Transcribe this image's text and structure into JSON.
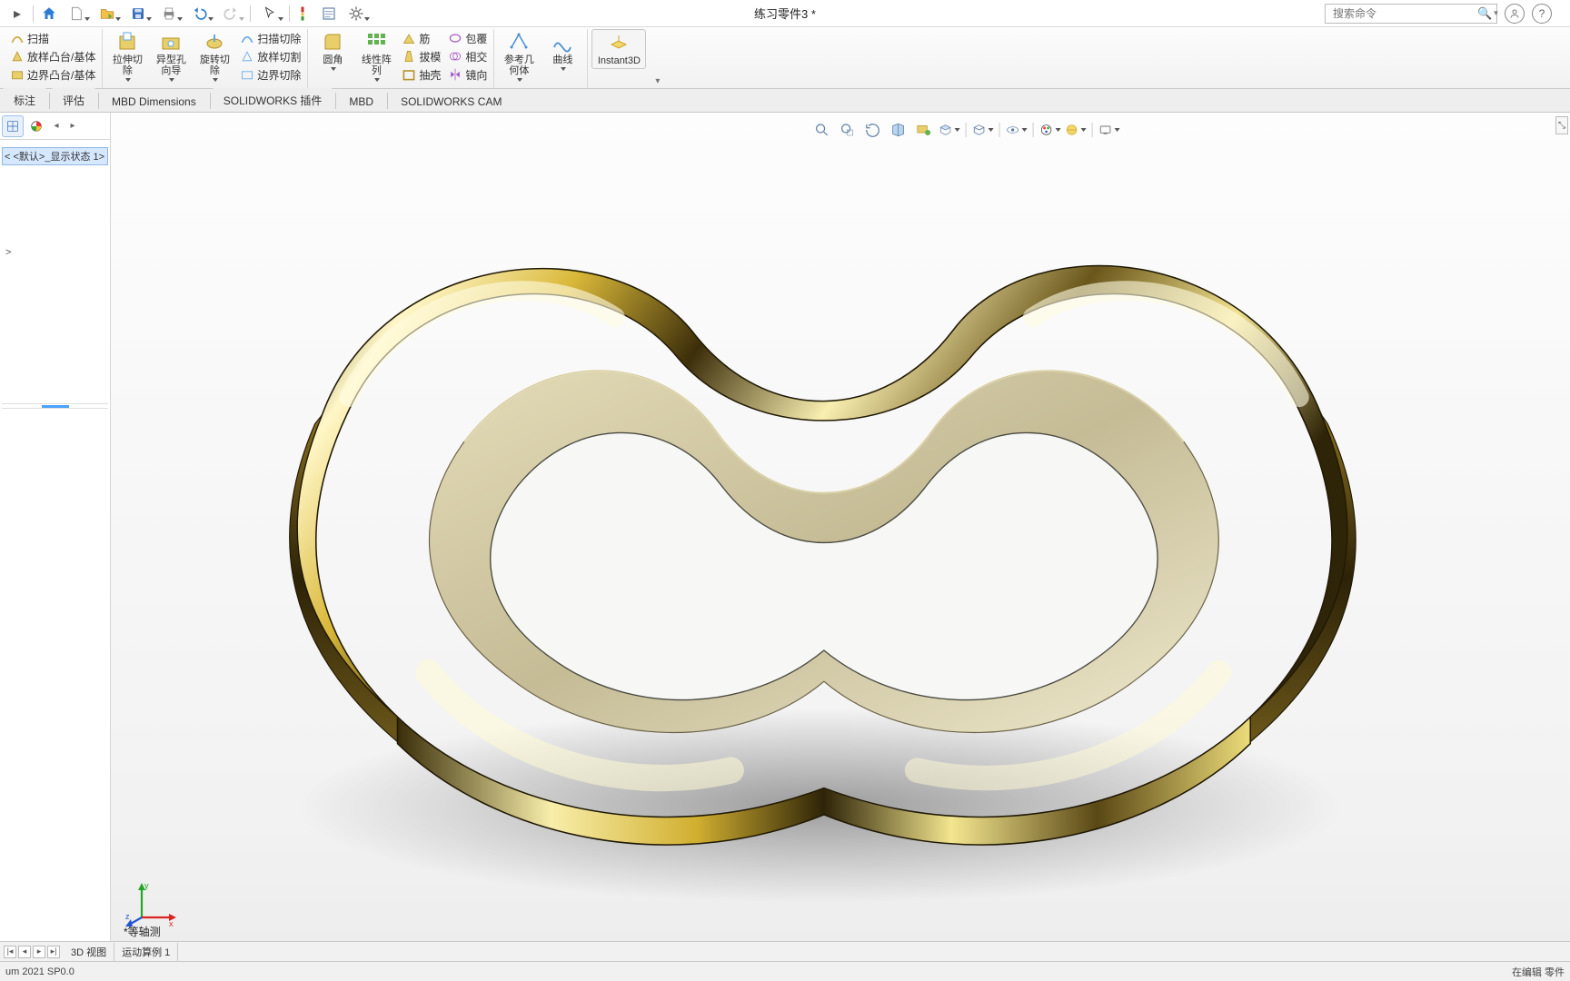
{
  "document_title": "练习零件3 *",
  "search_placeholder": "搜索命令",
  "ribbon": {
    "sweep": "扫描",
    "boss_base": "放样凸台/基体",
    "boundary_boss": "边界凸台/基体",
    "cut_extrude": "拉伸切除",
    "hole_wizard": "异型孔向导",
    "revolve_cut": "旋转切除",
    "sweep_cut": "扫描切除",
    "loft_cut": "放样切割",
    "boundary_cut": "边界切除",
    "fillet": "圆角",
    "linear_pattern": "线性阵列",
    "rib": "筋",
    "draft": "拔模",
    "shell": "抽壳",
    "wrap": "包覆",
    "intersect": "相交",
    "mirror": "镜向",
    "ref_geom": "参考几何体",
    "curves": "曲线",
    "instant3d": "Instant3D"
  },
  "tabs": {
    "t1": "标注",
    "t2": "评估",
    "t3": "MBD Dimensions",
    "t4": "SOLIDWORKS 插件",
    "t5": "MBD",
    "t6": "SOLIDWORKS CAM"
  },
  "tree": {
    "display_state": "< <默认>_显示状态 1>",
    "caret": ">"
  },
  "viewport_label": "*等轴测",
  "view_tabs": {
    "v1": "3D 视图",
    "v2": "运动算例 1"
  },
  "status_left": "um 2021 SP0.0",
  "status_right": "在编辑 零件",
  "icons": {
    "home": "home",
    "new": "new",
    "open": "open",
    "save": "save",
    "print": "print",
    "undo": "undo",
    "redo": "redo",
    "select": "select",
    "rebuild": "rebuild",
    "options": "options",
    "settings": "settings"
  }
}
